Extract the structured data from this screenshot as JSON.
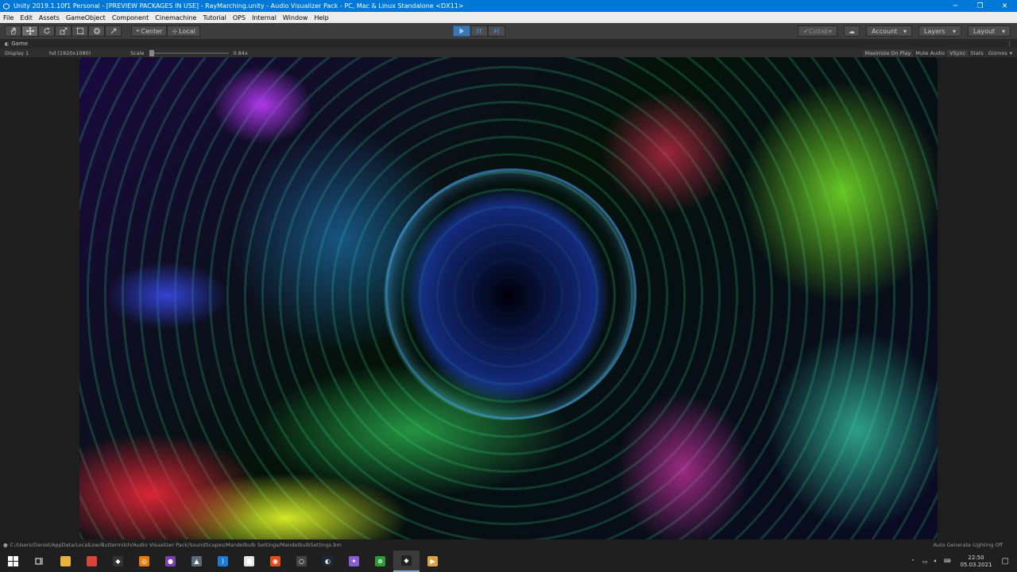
{
  "window": {
    "title": "Unity 2019.1.10f1 Personal - [PREVIEW PACKAGES IN USE] - RayMarching.unity - Audio Visualizer Pack - PC, Mac & Linux Standalone <DX11>",
    "controls": {
      "minimize": "─",
      "restore": "❐",
      "close": "✕"
    }
  },
  "menu": [
    "File",
    "Edit",
    "Assets",
    "GameObject",
    "Component",
    "Cinemachine",
    "Tutorial",
    "OPS",
    "Internal",
    "Window",
    "Help"
  ],
  "toolbar": {
    "tools": [
      "hand-tool-icon",
      "move-tool-icon",
      "rotate-tool-icon",
      "scale-tool-icon",
      "rect-tool-icon",
      "transform-tool-icon",
      "custom-tool-icon"
    ],
    "pivot_mode": "Center",
    "pivot_rotation": "Local",
    "collab": "Collab",
    "account": "Account",
    "layers": "Layers",
    "layout": "Layout",
    "play_state": "playing"
  },
  "game_view": {
    "tab_label": "Game",
    "display": "Display 1",
    "resolution": "hd (1920x1080)",
    "scale_label": "Scale",
    "scale_value": "0.84x",
    "maximize_on_play": "Maximize On Play",
    "mute_audio": "Mute Audio",
    "vsync": "VSync",
    "stats": "Stats",
    "gizmos": "Gizmos"
  },
  "status": {
    "path": "C:/Users/Daniel/AppData/LocalLow/Buttermilch/Audio Visualizer Pack/SoundScapes/Mandelbulb Settings/MandelbulbSettings.bm",
    "lighting": "Auto Generate Lighting Off"
  },
  "taskbar": {
    "apps": [
      {
        "name": "file-explorer",
        "color": "#e8b33c",
        "glyph": ""
      },
      {
        "name": "chrome",
        "color": "#db4437",
        "glyph": ""
      },
      {
        "name": "unity-hub",
        "color": "#333333",
        "glyph": "◆"
      },
      {
        "name": "blender",
        "color": "#e87d0d",
        "glyph": "◎"
      },
      {
        "name": "obs",
        "color": "#7a3fb0",
        "glyph": "●"
      },
      {
        "name": "app-gray",
        "color": "#5c6b7a",
        "glyph": "▲"
      },
      {
        "name": "visual-studio-code",
        "color": "#1f7ad6",
        "glyph": "⟩"
      },
      {
        "name": "app-white",
        "color": "#e6e6e6",
        "glyph": "■"
      },
      {
        "name": "app-orange",
        "color": "#e24d1d",
        "glyph": "◉"
      },
      {
        "name": "app-circle",
        "color": "#444444",
        "glyph": "○"
      },
      {
        "name": "steam",
        "color": "#1b2838",
        "glyph": "◐"
      },
      {
        "name": "app-multicolor",
        "color": "#8a5cd1",
        "glyph": "✦"
      },
      {
        "name": "xbox",
        "color": "#2a9d3a",
        "glyph": "⊗"
      },
      {
        "name": "unity",
        "color": "#222222",
        "glyph": "◆"
      },
      {
        "name": "app-yellow",
        "color": "#d9a441",
        "glyph": "▶"
      }
    ],
    "active_app": "unity",
    "time": "22:50",
    "date": "05.03.2021"
  }
}
